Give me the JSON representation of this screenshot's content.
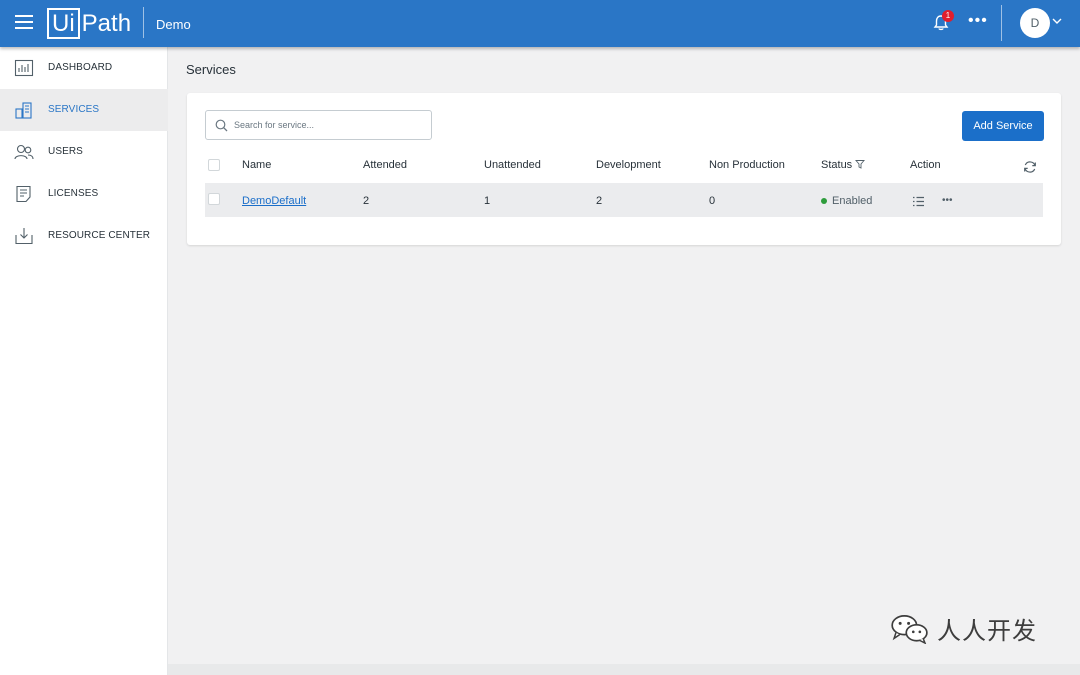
{
  "header": {
    "logo_text": "UiPath",
    "logo_boxed": "Ui",
    "logo_rest": "Path",
    "tenant": "Demo",
    "notification_count": "1",
    "more_label": "•••",
    "avatar_initial": "D",
    "icons": {
      "menu": "hamburger-icon",
      "bell": "bell-icon",
      "more": "ellipsis-icon",
      "chevron": "chevron-down-icon"
    },
    "bg_color": "#2a76c6"
  },
  "sidebar": {
    "items": [
      {
        "label": "DASHBOARD",
        "icon": "dashboard-chart-icon",
        "active": false
      },
      {
        "label": "SERVICES",
        "icon": "services-building-icon",
        "active": true
      },
      {
        "label": "USERS",
        "icon": "users-icon",
        "active": false
      },
      {
        "label": "LICENSES",
        "icon": "license-document-icon",
        "active": false
      },
      {
        "label": "RESOURCE CENTER",
        "icon": "download-tray-icon",
        "active": false
      }
    ]
  },
  "main": {
    "title": "Services",
    "search": {
      "placeholder": "Search for service...",
      "value": ""
    },
    "add_button": "Add Service",
    "table": {
      "columns": [
        "Name",
        "Attended",
        "Unattended",
        "Development",
        "Non Production",
        "Status",
        "Action"
      ],
      "rows": [
        {
          "name": "DemoDefault",
          "attended": "2",
          "unattended": "1",
          "development": "2",
          "non_production": "0",
          "status": "Enabled",
          "more": "•••"
        }
      ]
    },
    "accent_color": "#1b6fc9",
    "status_color": "#2d9c3b"
  },
  "watermark": {
    "text": "人人开发",
    "icon": "wechat-icon"
  }
}
